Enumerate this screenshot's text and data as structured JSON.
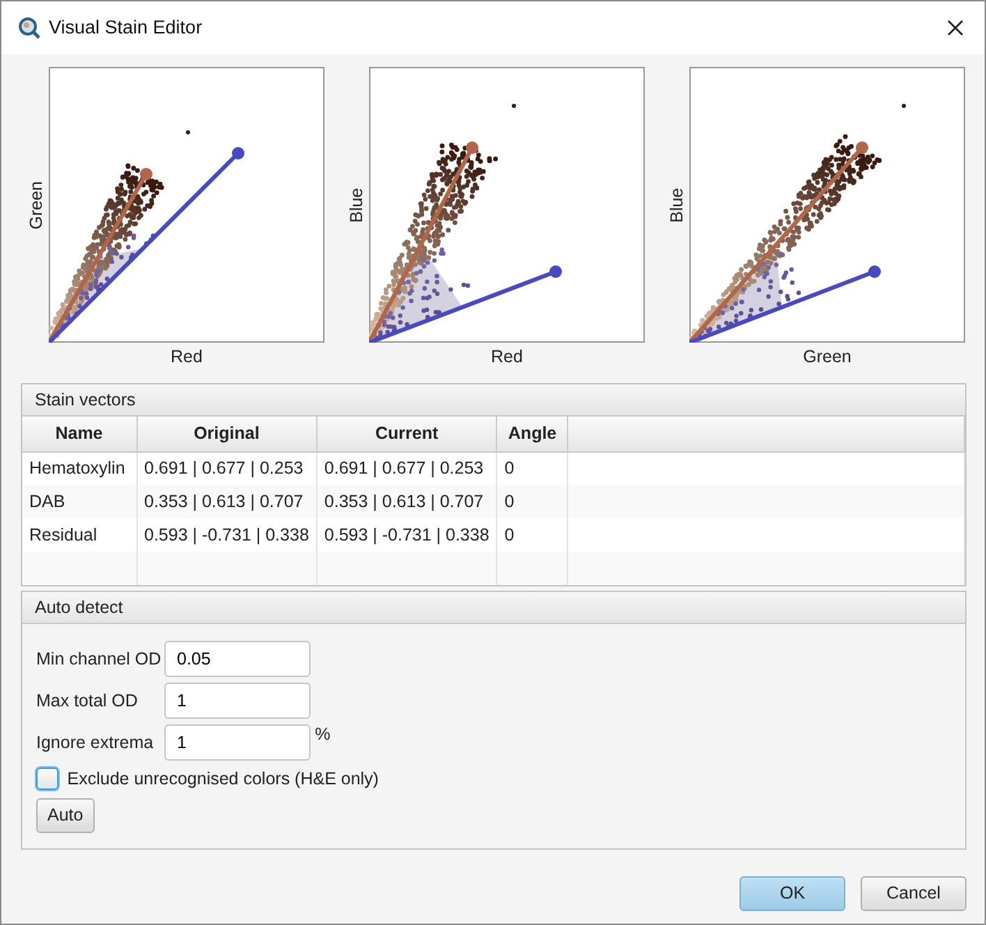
{
  "window": {
    "title": "Visual Stain Editor"
  },
  "plots": [
    {
      "x_label": "Red",
      "y_label": "Green"
    },
    {
      "x_label": "Red",
      "y_label": "Blue"
    },
    {
      "x_label": "Green",
      "y_label": "Blue"
    }
  ],
  "stain_vectors": {
    "title": "Stain vectors",
    "columns": [
      "Name",
      "Original",
      "Current",
      "Angle"
    ],
    "rows": [
      [
        "Hematoxylin",
        "0.691 | 0.677 | 0.253",
        "0.691 | 0.677 | 0.253",
        "0"
      ],
      [
        "DAB",
        "0.353 | 0.613 | 0.707",
        "0.353 | 0.613 | 0.707",
        "0"
      ],
      [
        "Residual",
        "0.593 | -0.731 | 0.338",
        "0.593 | -0.731 | 0.338",
        "0"
      ]
    ]
  },
  "auto_detect": {
    "title": "Auto detect",
    "fields": [
      {
        "label": "Min channel OD",
        "value": "0.05"
      },
      {
        "label": "Max total OD",
        "value": "1"
      },
      {
        "label": "Ignore extrema",
        "value": "1",
        "unit": "%"
      }
    ],
    "checkbox": {
      "label": "Exclude unrecognised colors (H&E only)",
      "checked": false
    },
    "button": "Auto"
  },
  "buttons": [
    {
      "label": "OK",
      "default": true
    },
    {
      "label": "Cancel",
      "default": false
    }
  ]
}
